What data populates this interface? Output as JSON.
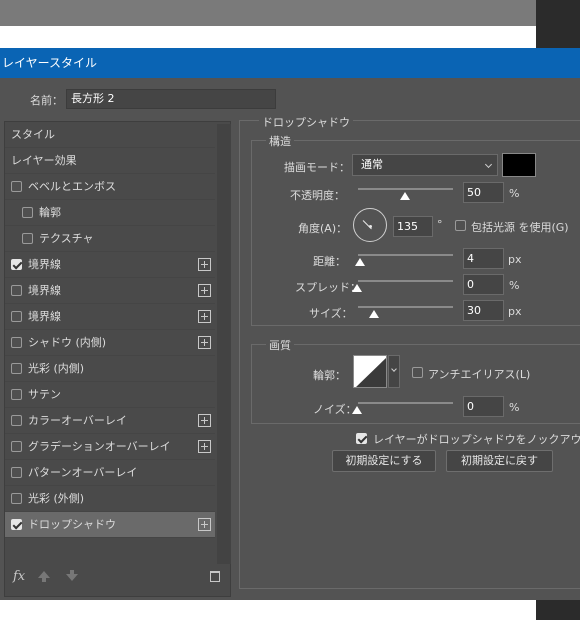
{
  "dialog": {
    "title": "レイヤースタイル"
  },
  "name": {
    "label": "名前：",
    "value": "長方形 2"
  },
  "styles": [
    {
      "label": "スタイル",
      "checkbox": false,
      "checked": false,
      "indent": false,
      "plus": false
    },
    {
      "label": "レイヤー効果",
      "checkbox": false,
      "checked": false,
      "indent": false,
      "plus": false
    },
    {
      "label": "ベベルとエンボス",
      "checkbox": true,
      "checked": false,
      "indent": false,
      "plus": false
    },
    {
      "label": "輪郭",
      "checkbox": true,
      "checked": false,
      "indent": true,
      "plus": false
    },
    {
      "label": "テクスチャ",
      "checkbox": true,
      "checked": false,
      "indent": true,
      "plus": false
    },
    {
      "label": "境界線",
      "checkbox": true,
      "checked": true,
      "indent": false,
      "plus": true
    },
    {
      "label": "境界線",
      "checkbox": true,
      "checked": false,
      "indent": false,
      "plus": true
    },
    {
      "label": "境界線",
      "checkbox": true,
      "checked": false,
      "indent": false,
      "plus": true
    },
    {
      "label": "シャドウ (内側)",
      "checkbox": true,
      "checked": false,
      "indent": false,
      "plus": true
    },
    {
      "label": "光彩 (内側)",
      "checkbox": true,
      "checked": false,
      "indent": false,
      "plus": false
    },
    {
      "label": "サテン",
      "checkbox": true,
      "checked": false,
      "indent": false,
      "plus": false
    },
    {
      "label": "カラーオーバーレイ",
      "checkbox": true,
      "checked": false,
      "indent": false,
      "plus": true
    },
    {
      "label": "グラデーションオーバーレイ",
      "checkbox": true,
      "checked": false,
      "indent": false,
      "plus": true
    },
    {
      "label": "パターンオーバーレイ",
      "checkbox": true,
      "checked": false,
      "indent": false,
      "plus": false
    },
    {
      "label": "光彩 (外側)",
      "checkbox": true,
      "checked": false,
      "indent": false,
      "plus": false
    },
    {
      "label": "ドロップシャドウ",
      "checkbox": true,
      "checked": true,
      "indent": false,
      "plus": true,
      "selected": true
    }
  ],
  "footer": {
    "fx": "fx"
  },
  "drop_shadow": {
    "title": "ドロップシャドウ",
    "structure": {
      "title": "構造",
      "blend_mode": {
        "label": "描画モード：",
        "value": "通常"
      },
      "color": "#000000",
      "opacity": {
        "label": "不透明度：",
        "value": "50",
        "unit": "%",
        "level": 0.5
      },
      "angle": {
        "label": "角度(A)：",
        "value": "135",
        "unit": "°"
      },
      "global_light": {
        "label": "包括光源 を使用(G)",
        "checked": false
      },
      "distance": {
        "label": "距離：",
        "value": "4",
        "unit": "px",
        "level": 0.0
      },
      "spread": {
        "label": "スプレッド：",
        "value": "0",
        "unit": "%",
        "level": 0.0
      },
      "size": {
        "label": "サイズ：",
        "value": "30",
        "unit": "px",
        "level": 0.2
      }
    },
    "quality": {
      "title": "画質",
      "contour": {
        "label": "輪郭："
      },
      "antialias": {
        "label": "アンチエイリアス(L)",
        "checked": false
      },
      "noise": {
        "label": "ノイズ：",
        "value": "0",
        "unit": "%",
        "level": 0.0
      }
    },
    "knockout": {
      "label": "レイヤーがドロップシャドウをノックアウト(U)",
      "checked": true
    },
    "buttons": {
      "make_default": "初期設定にする",
      "reset_default": "初期設定に戻す"
    }
  }
}
